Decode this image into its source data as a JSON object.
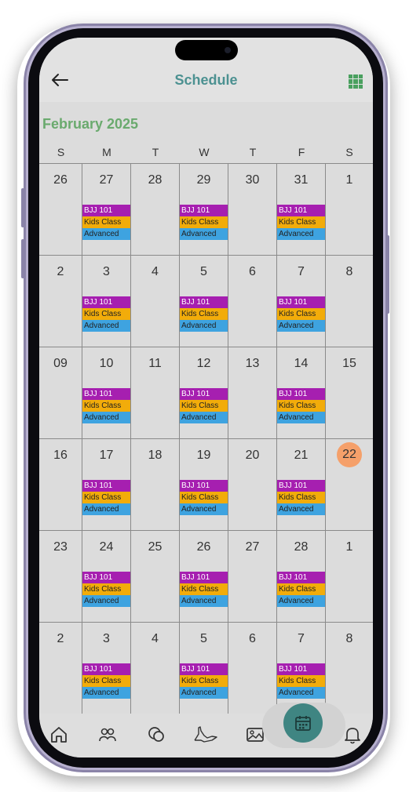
{
  "header": {
    "title": "Schedule",
    "back_icon": "arrow-left-icon",
    "view_icon": "grid-view-icon"
  },
  "calendar": {
    "month_label": "February 2025",
    "weekdays": [
      "S",
      "M",
      "T",
      "W",
      "T",
      "F",
      "S"
    ],
    "weeks": [
      [
        "26",
        "27",
        "28",
        "29",
        "30",
        "31",
        "1"
      ],
      [
        "2",
        "3",
        "4",
        "5",
        "6",
        "7",
        "8"
      ],
      [
        "09",
        "10",
        "11",
        "12",
        "13",
        "14",
        "15"
      ],
      [
        "16",
        "17",
        "18",
        "19",
        "20",
        "21",
        "22"
      ],
      [
        "23",
        "24",
        "25",
        "26",
        "27",
        "28",
        "1"
      ],
      [
        "2",
        "3",
        "4",
        "5",
        "6",
        "7",
        "8"
      ]
    ],
    "event_days": [
      1,
      3,
      5
    ],
    "today": "22",
    "events": [
      {
        "label": "BJJ 101",
        "color": "#a61fb0",
        "text_color": "#ffffff"
      },
      {
        "label": "Kids Class",
        "color": "#f2ac0a",
        "text_color": "#222222"
      },
      {
        "label": "Advanced",
        "color": "#3ea3e0",
        "text_color": "#222222"
      }
    ]
  },
  "bottom_nav": {
    "items": [
      "home-icon",
      "members-icon",
      "chat-icon",
      "hand-icon",
      "gallery-icon",
      "calendar-icon",
      "bell-icon"
    ],
    "active": "calendar-icon"
  },
  "colors": {
    "accent": "#4c9191",
    "month": "#6aaa6e",
    "today": "#f5a06a",
    "fab": "#3f8582"
  }
}
